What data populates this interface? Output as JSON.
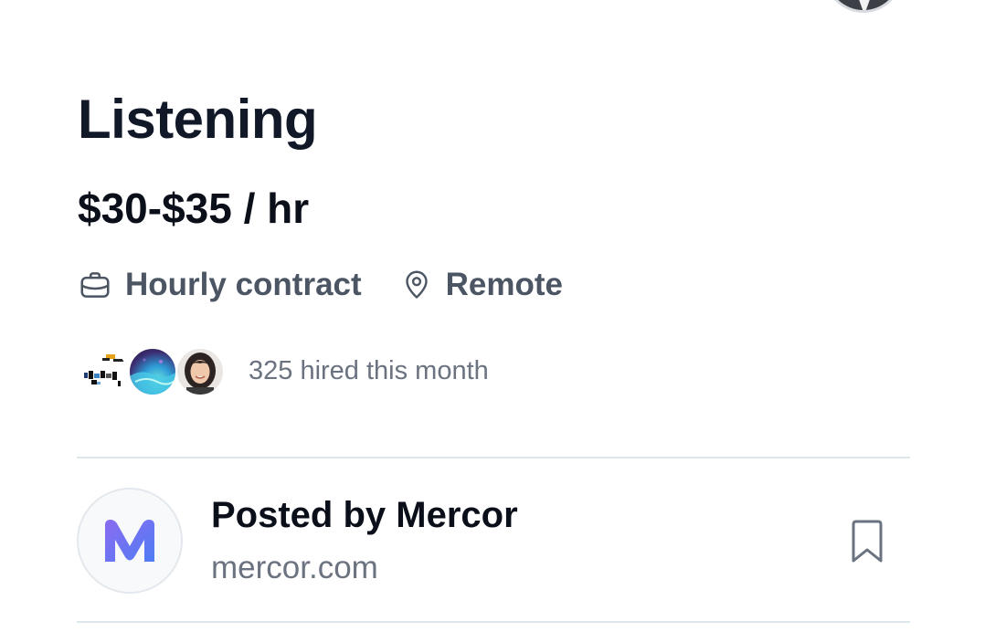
{
  "job": {
    "title": "Listening",
    "pay": "$30-$35 / hr",
    "contract_type": "Hourly contract",
    "location": "Remote",
    "hired_text": "325 hired this month"
  },
  "icons": {
    "contract": "briefcase-icon",
    "location": "map-pin-icon",
    "save": "bookmark-icon"
  },
  "company": {
    "posted_by": "Posted by Mercor",
    "domain": "mercor.com",
    "logo_letter": "M"
  },
  "colors": {
    "logo_gradient_start": "#7c6cf0",
    "logo_gradient_end": "#4f7cf5",
    "meta_text": "#4b5563",
    "muted_text": "#6b7280"
  }
}
